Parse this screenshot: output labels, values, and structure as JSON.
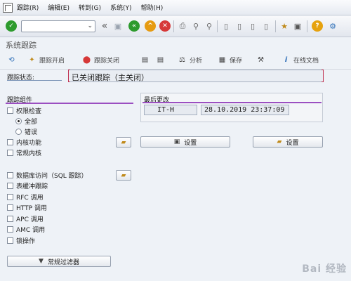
{
  "menu": {
    "items": [
      "跟踪(R)",
      "编辑(E)",
      "转到(G)",
      "系统(Y)",
      "帮助(H)"
    ]
  },
  "toolbar": {
    "command_value": ""
  },
  "page": {
    "title": "系统跟踪"
  },
  "apptoolbar": {
    "trace_on": "跟踪开启",
    "trace_off": "跟踪关闭",
    "analysis": "分析",
    "save": "保存",
    "online_doc": "在线文档"
  },
  "status": {
    "label": "跟踪状态:",
    "value": "已关闭跟踪（主关闭）"
  },
  "components": {
    "title": "跟踪组件",
    "authority_check": "权限检查",
    "radio_all": "全部",
    "radio_error": "错误",
    "kernel_functions": "内核功能",
    "general_kernel": "常规内核",
    "db_access": "数据库访问（SQL 跟踪）",
    "table_buffer": "表缓冲跟踪",
    "rfc_call": "RFC 调用",
    "http_call": "HTTP 调用",
    "apc_call": "APC 调用",
    "amc_call": "AMC 调用",
    "lock_ops": "锁操作",
    "general_filter": "常规过滤器"
  },
  "last_change": {
    "title": "最后更改",
    "user": "IT-H",
    "datetime": "28.10.2019 23:37:09",
    "settings_left": "设置",
    "settings_right": "设置"
  },
  "watermark": "Bai 经验",
  "colors": {
    "group_line": "#9b4fc1",
    "status_marker": "#c03050",
    "check_green": "#2e9b2e",
    "exit_yellow": "#e69b12",
    "cancel_red": "#d63838"
  }
}
